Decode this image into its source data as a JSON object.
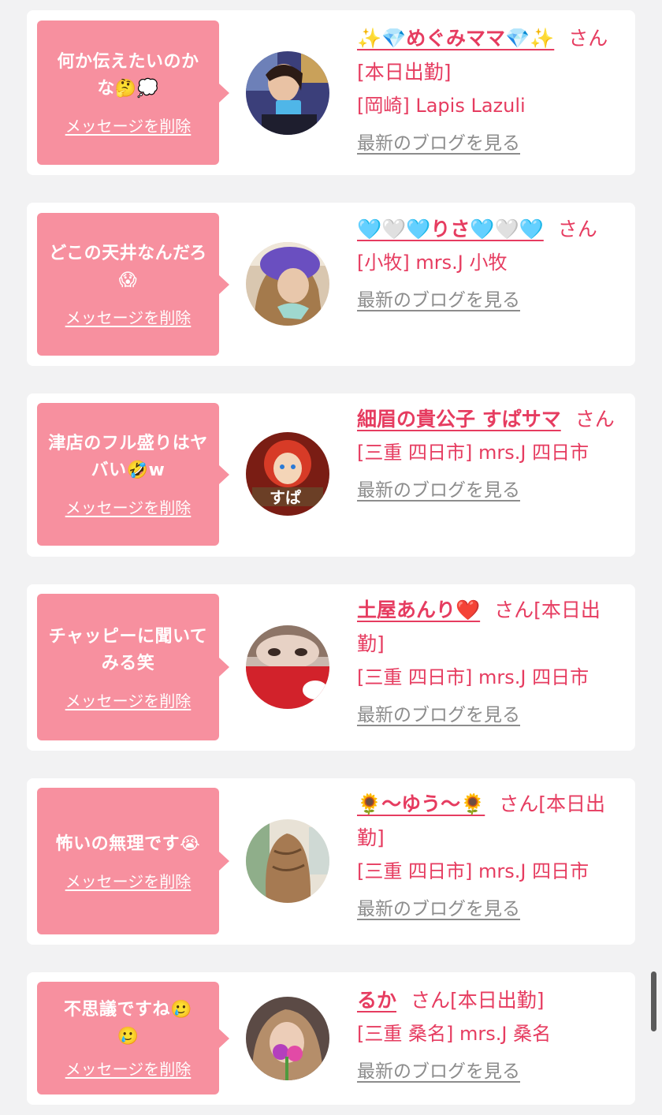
{
  "common": {
    "delete_label": "メッセージを削除",
    "blog_label": "最新のブログを見る"
  },
  "messages": [
    {
      "bubble_text": "何か伝えたいのかな🤔💭",
      "cast_name": "✨💎めぐみママ💎✨",
      "suffix": "さん[本日出勤]",
      "shop": "[岡崎] Lapis Lazuli"
    },
    {
      "bubble_text": "どこの天井なんだろ😱",
      "cast_name": "🩵🤍🩵りさ🩵🤍🩵",
      "suffix": "さん",
      "shop": "[小牧] mrs.J 小牧"
    },
    {
      "bubble_text": "津店のフル盛りはヤバい🤣w",
      "cast_name": "細眉の貴公子 すぱサマ",
      "suffix": "さん",
      "shop": "[三重 四日市] mrs.J 四日市"
    },
    {
      "bubble_text": "チャッピーに聞いてみる笑",
      "cast_name": "土屋あんり❤️",
      "suffix": "さん[本日出勤]",
      "shop": "[三重 四日市] mrs.J 四日市"
    },
    {
      "bubble_text": "怖いの無理です😭",
      "cast_name": "🌻〜ゆう〜🌻",
      "suffix": "さん[本日出勤]",
      "shop": "[三重 四日市] mrs.J 四日市"
    },
    {
      "bubble_text": "不思議ですね🥲🥲",
      "cast_name": "るか",
      "suffix": "さん[本日出勤]",
      "shop": "[三重 桑名] mrs.J 桑名"
    }
  ],
  "colors": {
    "page_bg": "#f2f2f3",
    "card_bg": "#ffffff",
    "bubble_bg": "#f7909f",
    "accent": "#e63c60",
    "link_gray": "#8c8c8c"
  }
}
